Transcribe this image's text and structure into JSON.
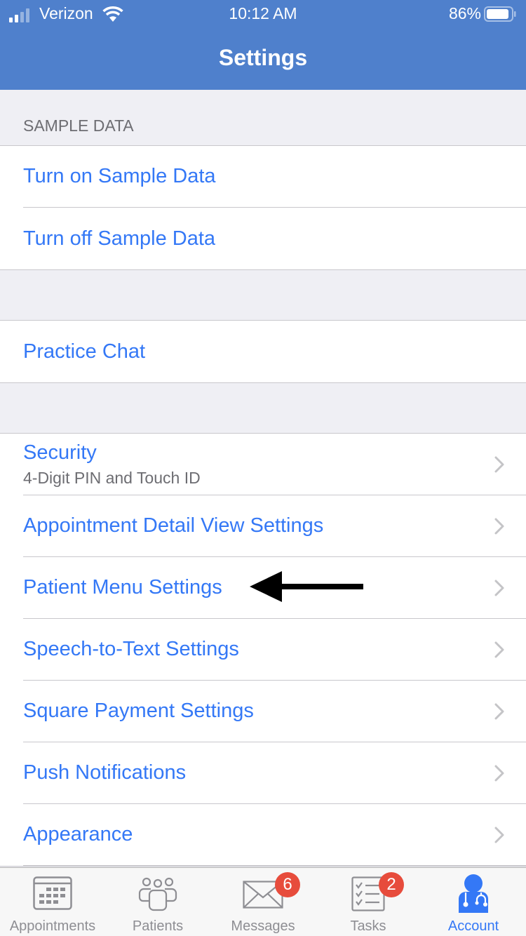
{
  "status_bar": {
    "carrier": "Verizon",
    "time": "10:12 AM",
    "battery_percent": "86%",
    "signal_bars_filled": 2,
    "signal_bars_total": 4,
    "battery_level": 0.86
  },
  "nav": {
    "title": "Settings"
  },
  "colors": {
    "nav_bg": "#4f80cc",
    "accent": "#3478f6",
    "badge": "#e74c3c",
    "secondary_text": "#6d6d72"
  },
  "sections": {
    "sample_data": {
      "header": "SAMPLE DATA",
      "items": [
        {
          "label": "Turn on Sample Data"
        },
        {
          "label": "Turn off Sample Data"
        }
      ]
    },
    "chat": {
      "items": [
        {
          "label": "Practice Chat"
        }
      ]
    },
    "settings": {
      "items": [
        {
          "label": "Security",
          "subtitle": "4-Digit PIN and Touch ID"
        },
        {
          "label": "Appointment Detail View Settings"
        },
        {
          "label": "Patient Menu Settings"
        },
        {
          "label": "Speech-to-Text Settings"
        },
        {
          "label": "Square Payment Settings"
        },
        {
          "label": "Push Notifications"
        },
        {
          "label": "Appearance"
        }
      ]
    }
  },
  "annotation": {
    "arrow_target": "Patient Menu Settings"
  },
  "tabbar": {
    "tabs": [
      {
        "label": "Appointments",
        "icon": "calendar-icon"
      },
      {
        "label": "Patients",
        "icon": "people-icon"
      },
      {
        "label": "Messages",
        "icon": "envelope-icon",
        "badge": "6"
      },
      {
        "label": "Tasks",
        "icon": "checklist-icon",
        "badge": "2"
      },
      {
        "label": "Account",
        "icon": "doctor-icon",
        "active": true
      }
    ]
  }
}
